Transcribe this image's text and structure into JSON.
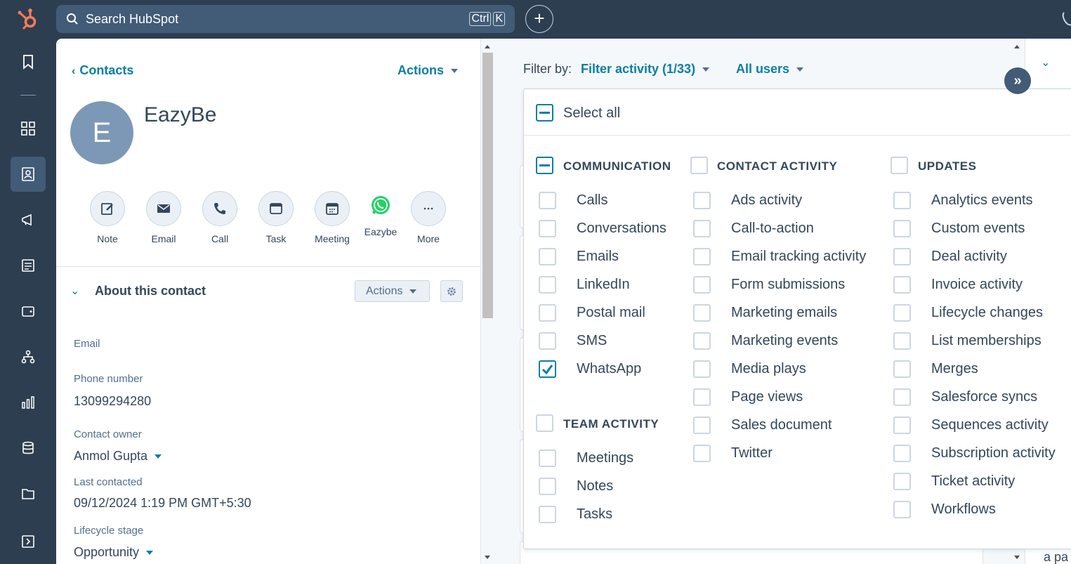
{
  "search": {
    "placeholder": "Search HubSpot",
    "shortcut_ctrl": "Ctrl",
    "shortcut_key": "K"
  },
  "add_label": "+",
  "contact": {
    "back_label": "Contacts",
    "actions_label": "Actions",
    "avatar_letter": "E",
    "name": "EazyBe"
  },
  "quick_actions": [
    "Note",
    "Email",
    "Call",
    "Task",
    "Meeting",
    "Eazybe",
    "More"
  ],
  "about": {
    "title": "About this contact",
    "actions_label": "Actions",
    "email_label": "Email",
    "phone_label": "Phone number",
    "phone_value": "13099294280",
    "owner_label": "Contact owner",
    "owner_value": "Anmol Gupta",
    "last_contacted_label": "Last contacted",
    "last_contacted_value": "09/12/2024 1:19 PM GMT+5:30",
    "lifecycle_label": "Lifecycle stage",
    "lifecycle_value": "Opportunity"
  },
  "filter": {
    "by_label": "Filter by:",
    "activity_label": "Filter activity (1/33)",
    "users_label": "All users",
    "select_all": "Select all",
    "communication": {
      "heading": "COMMUNICATION",
      "items": [
        "Calls",
        "Conversations",
        "Emails",
        "LinkedIn",
        "Postal mail",
        "SMS",
        "WhatsApp"
      ],
      "checked": "WhatsApp"
    },
    "team_activity": {
      "heading": "TEAM ACTIVITY",
      "items": [
        "Meetings",
        "Notes",
        "Tasks"
      ]
    },
    "contact_activity": {
      "heading": "CONTACT ACTIVITY",
      "items": [
        "Ads activity",
        "Call-to-action",
        "Email tracking activity",
        "Form submissions",
        "Marketing emails",
        "Marketing events",
        "Media plays",
        "Page views",
        "Sales document",
        "Twitter"
      ]
    },
    "updates": {
      "heading": "UPDATES",
      "items": [
        "Analytics events",
        "Custom events",
        "Deal activity",
        "Invoice activity",
        "Lifecycle changes",
        "List memberships",
        "Merges",
        "Salesforce syncs",
        "Sequences activity",
        "Subscription activity",
        "Ticket activity",
        "Workflows"
      ]
    }
  },
  "right_panel": {
    "partial_text": "a pa"
  },
  "colors": {
    "nav_bg": "#2d3e50",
    "accent": "#0b7fa3",
    "logo": "#ff7a59",
    "whatsapp": "#25d366"
  }
}
